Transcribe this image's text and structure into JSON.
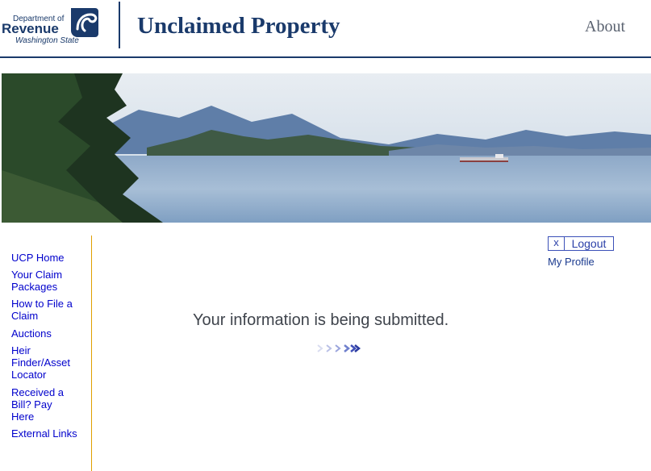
{
  "header": {
    "logo": {
      "line1": "Department of",
      "line2": "Revenue",
      "line3": "Washington State",
      "icon": "dor-swirl-icon",
      "color": "#1a3a6b"
    },
    "title": "Unclaimed Property",
    "about_label": "About"
  },
  "banner": {
    "icon": "scenic-water-mountains-image"
  },
  "sidebar": {
    "items": [
      {
        "label": "UCP Home"
      },
      {
        "label": "Your Claim Packages"
      },
      {
        "label": "How to File a Claim"
      },
      {
        "label": "Auctions"
      },
      {
        "label": "Heir Finder/Asset Locator"
      },
      {
        "label": "Received a Bill? Pay Here"
      },
      {
        "label": "External Links"
      }
    ],
    "border_color": "#e0a000"
  },
  "account": {
    "logout_x": "x",
    "logout_label": "Logout",
    "profile_label": "My Profile"
  },
  "main": {
    "status_message": "Your information is being submitted.",
    "progress_icon": "progress-arrows-icon"
  },
  "colors": {
    "brand": "#1a3a6b",
    "link": "#0000cc",
    "accent_border": "#e0a000"
  }
}
